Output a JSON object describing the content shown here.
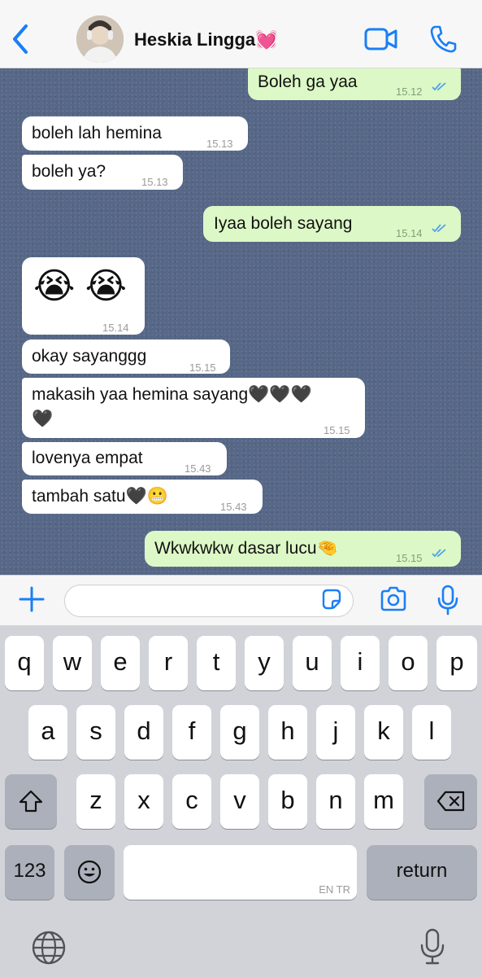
{
  "header": {
    "contact_name": "Heskia Lingga💓",
    "icons": {
      "back": "chevron-left-icon",
      "video": "video-camera-icon",
      "call": "phone-icon"
    },
    "accent_color": "#1a7ff6"
  },
  "messages": [
    {
      "dir": "out",
      "text": "Boleh ga yaa",
      "time": "15.12",
      "read": true
    },
    {
      "dir": "in",
      "text": "boleh lah hemina",
      "time": "15.13"
    },
    {
      "dir": "in",
      "text": "boleh ya?",
      "time": "15.13"
    },
    {
      "dir": "out",
      "text": "Iyaa boleh sayang",
      "time": "15.14",
      "read": true
    },
    {
      "dir": "in",
      "text": "😭 😭",
      "time": "15.14"
    },
    {
      "dir": "in",
      "text": "okay sayanggg",
      "time": "15.15"
    },
    {
      "dir": "in",
      "text_line1": "makasih yaa hemina sayang🖤🖤🖤",
      "text_line2": "🖤",
      "time": "15.15"
    },
    {
      "dir": "in",
      "text": "lovenya empat",
      "time": "15.43"
    },
    {
      "dir": "in",
      "text": "tambah satu🖤😬",
      "time": "15.43"
    },
    {
      "dir": "out",
      "text": "Wkwkwkw dasar lucu🤏",
      "time": "15.15",
      "read": true
    }
  ],
  "composer": {
    "input_value": "",
    "icons": {
      "plus": "plus-icon",
      "sticker": "sticker-icon",
      "camera": "camera-icon",
      "mic": "microphone-icon"
    }
  },
  "keyboard": {
    "row1": [
      "q",
      "w",
      "e",
      "r",
      "t",
      "y",
      "u",
      "i",
      "o",
      "p"
    ],
    "row2": [
      "a",
      "s",
      "d",
      "f",
      "g",
      "h",
      "j",
      "k",
      "l"
    ],
    "row3": [
      "z",
      "x",
      "c",
      "v",
      "b",
      "n",
      "m"
    ],
    "numbers_key": "123",
    "return_key": "return",
    "space_langs": "EN TR",
    "icons": {
      "shift": "shift-icon",
      "delete": "backspace-icon",
      "emoji": "emoji-icon",
      "globe": "globe-icon",
      "dictation": "microphone-icon"
    }
  },
  "colors": {
    "chat_bg": "#566787",
    "bubble_in": "#ffffff",
    "bubble_out": "#dcf8c6",
    "read_ticks": "#4fa3e8"
  }
}
